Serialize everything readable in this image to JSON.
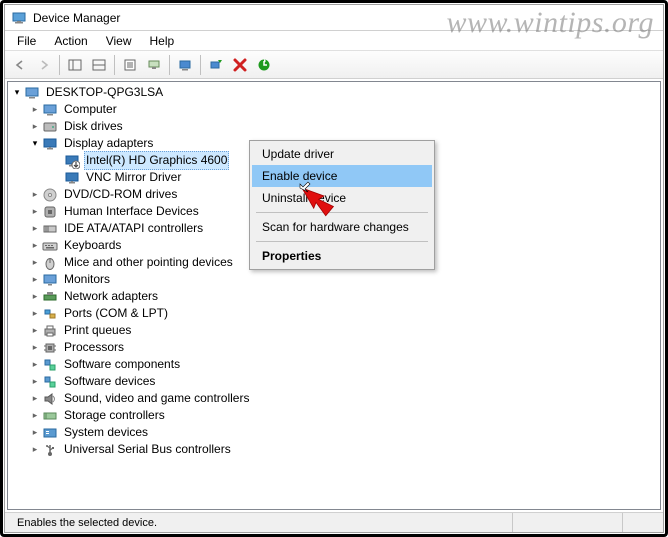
{
  "watermark": "www.wintips.org",
  "window": {
    "title": "Device Manager"
  },
  "menubar": [
    "File",
    "Action",
    "View",
    "Help"
  ],
  "tree": {
    "root": {
      "label": "DESKTOP-QPG3LSA"
    },
    "items": [
      {
        "label": "Computer",
        "icon": "computer"
      },
      {
        "label": "Disk drives",
        "icon": "disk"
      },
      {
        "label": "Display adapters",
        "icon": "display",
        "expanded": true,
        "children": [
          {
            "label": "Intel(R) HD Graphics 4600",
            "icon": "display",
            "selected": true,
            "disabled": true
          },
          {
            "label": "VNC Mirror Driver",
            "icon": "display"
          }
        ]
      },
      {
        "label": "DVD/CD-ROM drives",
        "icon": "dvd"
      },
      {
        "label": "Human Interface Devices",
        "icon": "hid"
      },
      {
        "label": "IDE ATA/ATAPI controllers",
        "icon": "ide"
      },
      {
        "label": "Keyboards",
        "icon": "keyboard"
      },
      {
        "label": "Mice and other pointing devices",
        "icon": "mouse"
      },
      {
        "label": "Monitors",
        "icon": "monitor"
      },
      {
        "label": "Network adapters",
        "icon": "network"
      },
      {
        "label": "Ports (COM & LPT)",
        "icon": "ports"
      },
      {
        "label": "Print queues",
        "icon": "printer"
      },
      {
        "label": "Processors",
        "icon": "cpu"
      },
      {
        "label": "Software components",
        "icon": "software"
      },
      {
        "label": "Software devices",
        "icon": "software"
      },
      {
        "label": "Sound, video and game controllers",
        "icon": "sound"
      },
      {
        "label": "Storage controllers",
        "icon": "storage"
      },
      {
        "label": "System devices",
        "icon": "system"
      },
      {
        "label": "Universal Serial Bus controllers",
        "icon": "usb"
      }
    ]
  },
  "context_menu": {
    "items": [
      {
        "label": "Update driver"
      },
      {
        "label": "Enable device",
        "highlight": true
      },
      {
        "label": "Uninstall device"
      },
      {
        "sep": true
      },
      {
        "label": "Scan for hardware changes"
      },
      {
        "sep": true
      },
      {
        "label": "Properties",
        "bold": true
      }
    ]
  },
  "statusbar": {
    "text": "Enables the selected device."
  }
}
